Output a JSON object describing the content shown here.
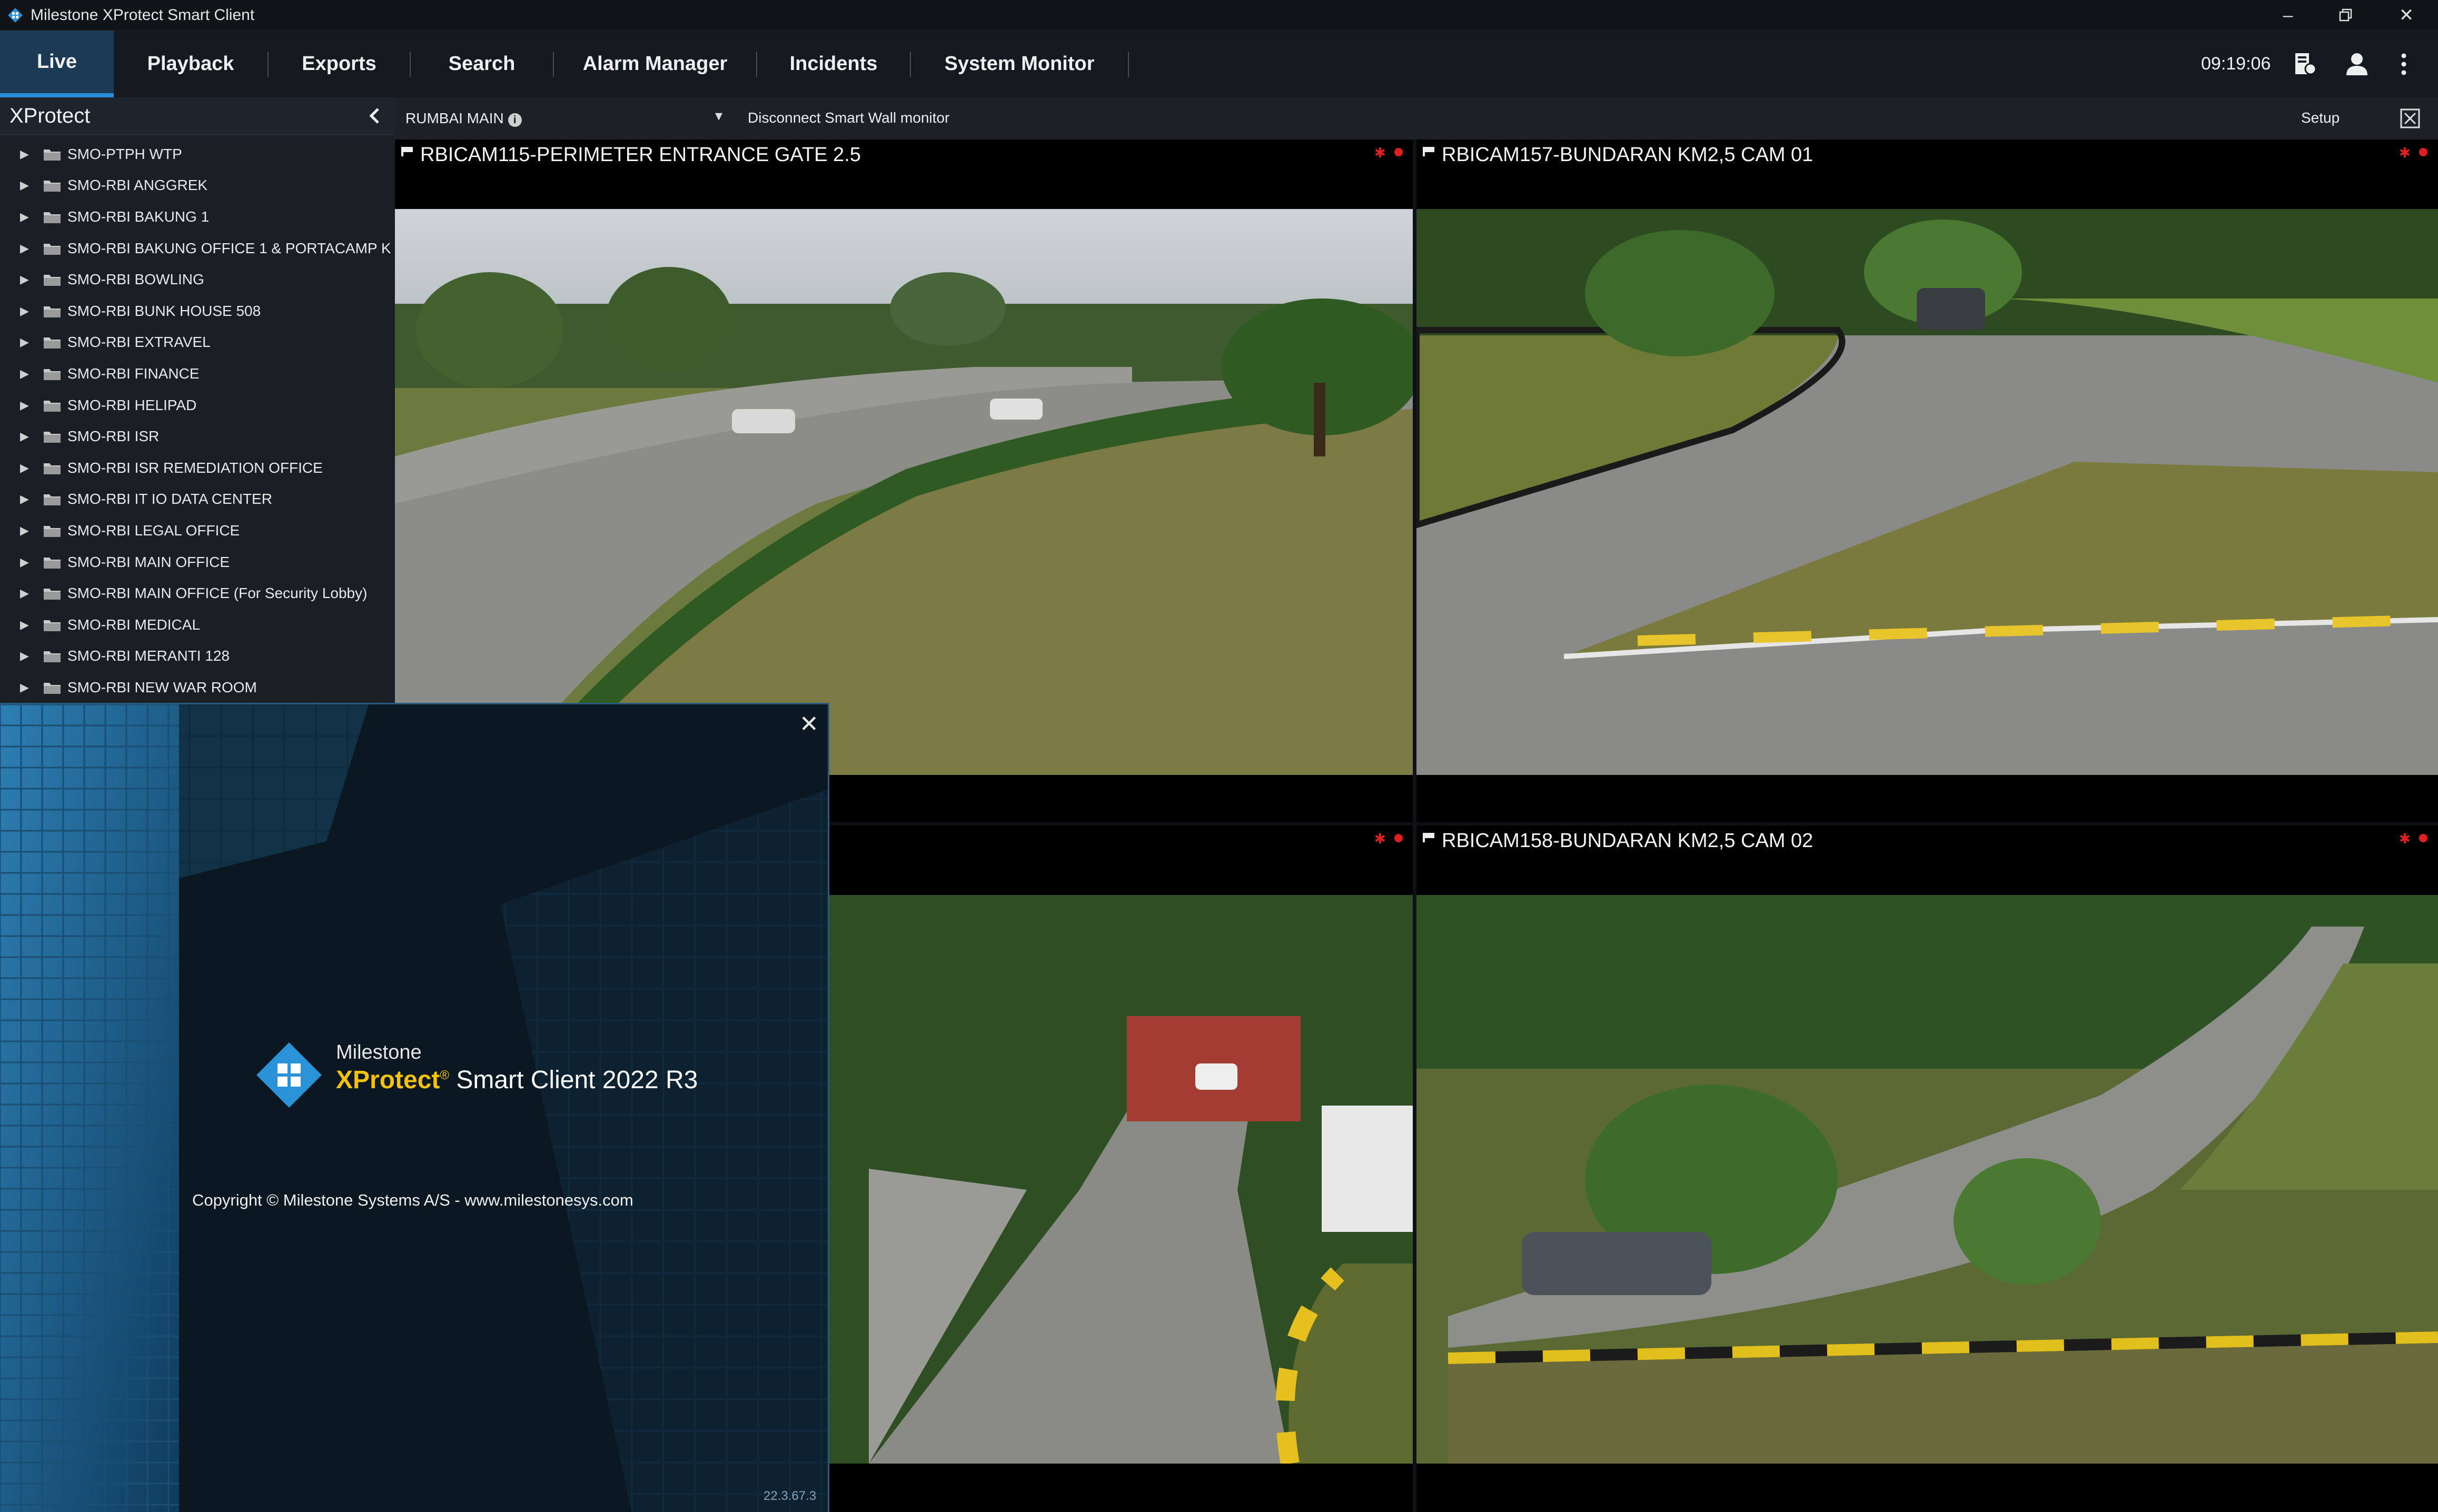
{
  "window": {
    "title": "Milestone XProtect Smart Client",
    "controls": [
      "minimize-icon",
      "restore-icon",
      "close-icon"
    ]
  },
  "menubar": {
    "tabs": [
      {
        "label": "Live",
        "active": true
      },
      {
        "label": "Playback"
      },
      {
        "label": "Exports"
      },
      {
        "label": "Search"
      },
      {
        "label": "Alarm Manager"
      },
      {
        "label": "Incidents"
      },
      {
        "label": "System Monitor"
      }
    ],
    "clock": "09:19:06",
    "icons": [
      "status-icon",
      "user-icon",
      "more-icon"
    ]
  },
  "sidebar": {
    "title": "XProtect",
    "items": [
      "SMO-PTPH WTP",
      "SMO-RBI ANGGREK",
      "SMO-RBI BAKUNG 1",
      "SMO-RBI BAKUNG OFFICE 1 & PORTACAMP K",
      "SMO-RBI BOWLING",
      "SMO-RBI BUNK HOUSE 508",
      "SMO-RBI EXTRAVEL",
      "SMO-RBI FINANCE",
      "SMO-RBI HELIPAD",
      "SMO-RBI ISR",
      "SMO-RBI ISR REMEDIATION OFFICE",
      "SMO-RBI IT IO DATA CENTER",
      "SMO-RBI LEGAL OFFICE",
      "SMO-RBI MAIN OFFICE",
      "SMO-RBI MAIN OFFICE (For Security Lobby)",
      "SMO-RBI MEDICAL",
      "SMO-RBI MERANTI 128",
      "SMO-RBI NEW WAR ROOM"
    ]
  },
  "viewbar": {
    "view_name": "RUMBAI MAIN",
    "disconnect": "Disconnect Smart Wall monitor",
    "setup": "Setup"
  },
  "cameras": [
    {
      "title": "RBICAM115-PERIMETER ENTRANCE GATE 2.5",
      "selected": true
    },
    {
      "title": "RBICAM157-BUNDARAN KM2,5 CAM 01"
    },
    {
      "title": ""
    },
    {
      "title": "RBICAM158-BUNDARAN KM2,5 CAM 02"
    }
  ],
  "splash": {
    "brand_small": "Milestone",
    "brand_product": "XProtect",
    "brand_reg": "®",
    "brand_rest": " Smart Client 2022 R3",
    "copyright": "Copyright © Milestone Systems A/S - www.milestonesys.com",
    "version": "22.3.67.3"
  },
  "colors": {
    "accent": "#2a8fd8",
    "active_tab_bg": "#1b3a55",
    "rec_red": "#e02020",
    "xprotect_yellow": "#f4c20d"
  }
}
